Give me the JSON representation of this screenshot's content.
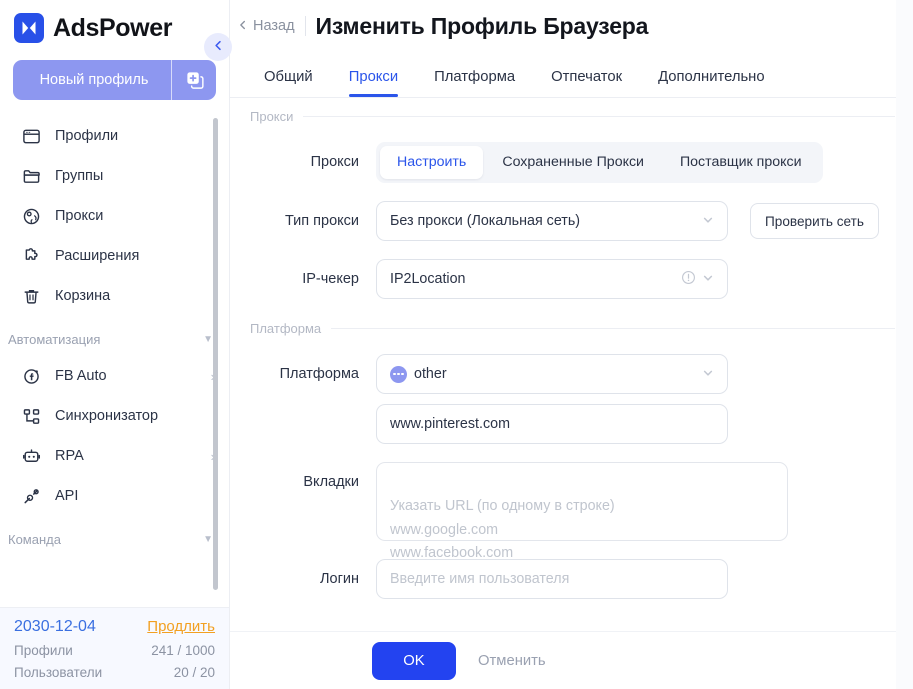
{
  "brand": {
    "name": "AdsPower",
    "logo_icon": "adspower-logo-icon"
  },
  "sidebar": {
    "new_profile": {
      "label": "Новый профиль",
      "icon": "add-profile-icon"
    },
    "collapse_icon": "chevron-left-icon",
    "items": [
      {
        "label": "Профили",
        "icon": "browser-window-icon",
        "arrow": ""
      },
      {
        "label": "Группы",
        "icon": "folder-icon",
        "arrow": ""
      },
      {
        "label": "Прокси",
        "icon": "globe-proxy-icon",
        "arrow": ""
      },
      {
        "label": "Расширения",
        "icon": "puzzle-piece-icon",
        "arrow": ""
      },
      {
        "label": "Корзина",
        "icon": "trash-icon",
        "arrow": ""
      }
    ],
    "groups": [
      {
        "title": "Автоматизация",
        "caret_icon": "chevron-down-icon",
        "items": [
          {
            "label": "FB Auto",
            "icon": "facebook-auto-icon",
            "arrow": "›"
          },
          {
            "label": "Синхронизатор",
            "icon": "sync-nodes-icon",
            "arrow": ""
          },
          {
            "label": "RPA",
            "icon": "robot-icon",
            "arrow": "›"
          },
          {
            "label": "API",
            "icon": "api-plug-icon",
            "arrow": ""
          }
        ]
      },
      {
        "title": "Команда",
        "caret_icon": "chevron-down-icon",
        "items": []
      }
    ],
    "footer": {
      "expiry_date": "2030-12-04",
      "renew_label": "Продлить",
      "profiles_label": "Профили",
      "profiles_value": "241 / 1000",
      "users_label": "Пользователи",
      "users_value": "20 / 20"
    }
  },
  "header": {
    "back_label": "Назад",
    "back_icon": "chevron-left-icon",
    "title": "Изменить Профиль Браузера"
  },
  "tabs": [
    {
      "label": "Общий",
      "active": false
    },
    {
      "label": "Прокси",
      "active": true
    },
    {
      "label": "Платформа",
      "active": false
    },
    {
      "label": "Отпечаток",
      "active": false
    },
    {
      "label": "Дополнительно",
      "active": false
    }
  ],
  "sections": {
    "proxy": {
      "heading": "Прокси",
      "proxy_row_label": "Прокси",
      "modes": [
        {
          "label": "Настроить",
          "active": true
        },
        {
          "label": "Сохраненные Прокси",
          "active": false
        },
        {
          "label": "Поставщик прокси",
          "active": false
        }
      ],
      "proxy_type": {
        "label": "Тип прокси",
        "value": "Без прокси (Локальная сеть)",
        "chevron_icon": "chevron-down-icon"
      },
      "check_network_label": "Проверить сеть",
      "ip_checker": {
        "label": "IP-чекер",
        "value": "IP2Location",
        "warn_icon": "exclamation-circle-icon",
        "chevron_icon": "chevron-down-icon"
      }
    },
    "platform": {
      "heading": "Платформа",
      "platform_row": {
        "label": "Платформа",
        "value": "other",
        "icon": "platform-other-icon",
        "chevron_icon": "chevron-down-icon"
      },
      "url": {
        "value": "www.pinterest.com"
      },
      "tabs_field": {
        "label": "Вкладки",
        "placeholder": "Указать URL (по одному в строке)\nwww.google.com\nwww.facebook.com"
      },
      "login_field": {
        "label": "Логин",
        "placeholder": "Введите имя пользователя",
        "value": ""
      }
    }
  },
  "actions": {
    "ok_label": "OK",
    "cancel_label": "Отменить"
  },
  "colors": {
    "primary_blue": "#2343f0",
    "tab_blue": "#2b55ea",
    "periwinkle": "#8d97f0",
    "renew_orange": "#f2a022",
    "date_blue": "#3a6fe0"
  }
}
